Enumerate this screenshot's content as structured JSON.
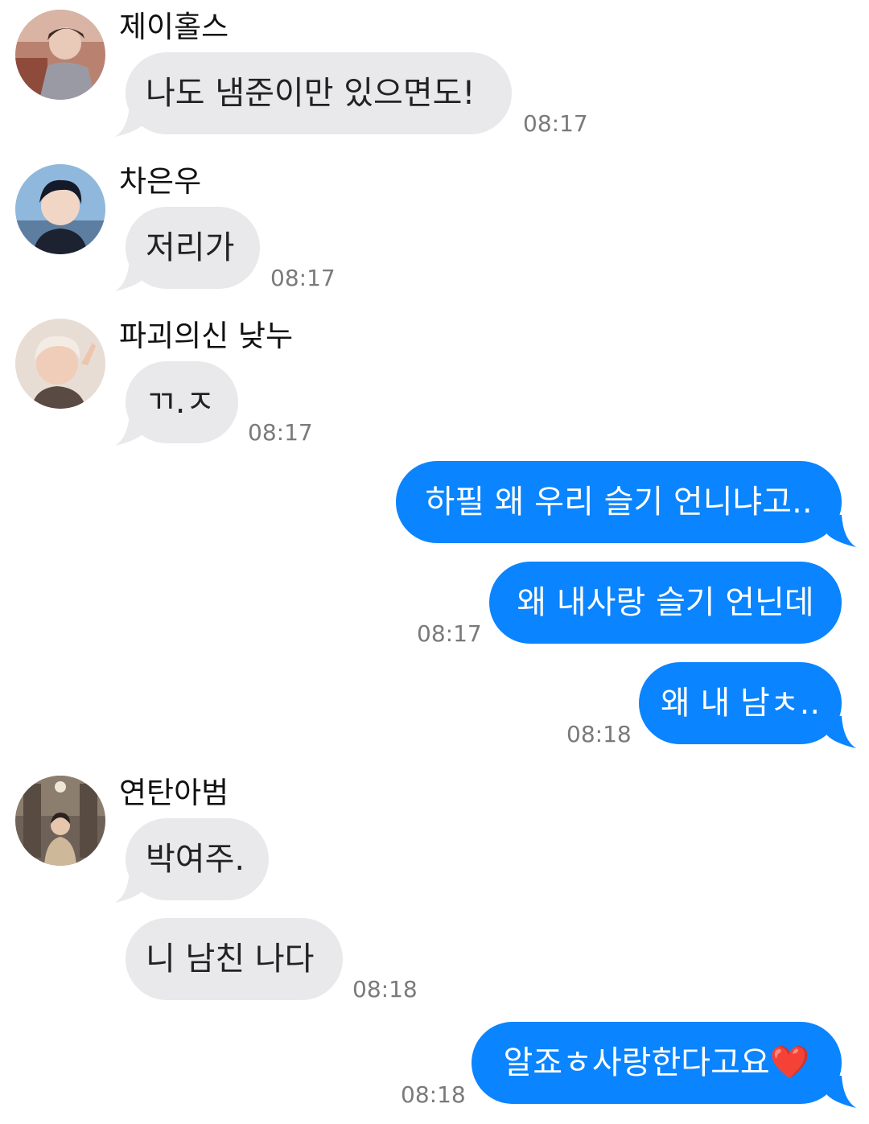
{
  "messages": [
    {
      "sender": "제이홀스",
      "text": "나도 냄준이만 있으면도!",
      "time": "08:17"
    },
    {
      "sender": "차은우",
      "text": "저리가",
      "time": "08:17"
    },
    {
      "sender": "파괴의신 낮누",
      "text": "ㄲ.ㅈ",
      "time": "08:17"
    },
    {
      "text": "하필 왜 우리 슬기 언니냐고.."
    },
    {
      "text": "왜 내사랑 슬기 언닌데",
      "time": "08:17"
    },
    {
      "text": "왜 내 남ㅊ..",
      "time": "08:18"
    },
    {
      "sender": "연탄아범",
      "text": "박여주."
    },
    {
      "text": "니 남친 나다",
      "time": "08:18"
    },
    {
      "text": "알죠ㅎ사랑한다고요❤️",
      "time": "08:18"
    }
  ],
  "colors": {
    "incoming_bubble": "#e9e9eb",
    "outgoing_bubble": "#0a84ff",
    "timestamp": "#7a7a7a",
    "heart": "#e0242b"
  }
}
